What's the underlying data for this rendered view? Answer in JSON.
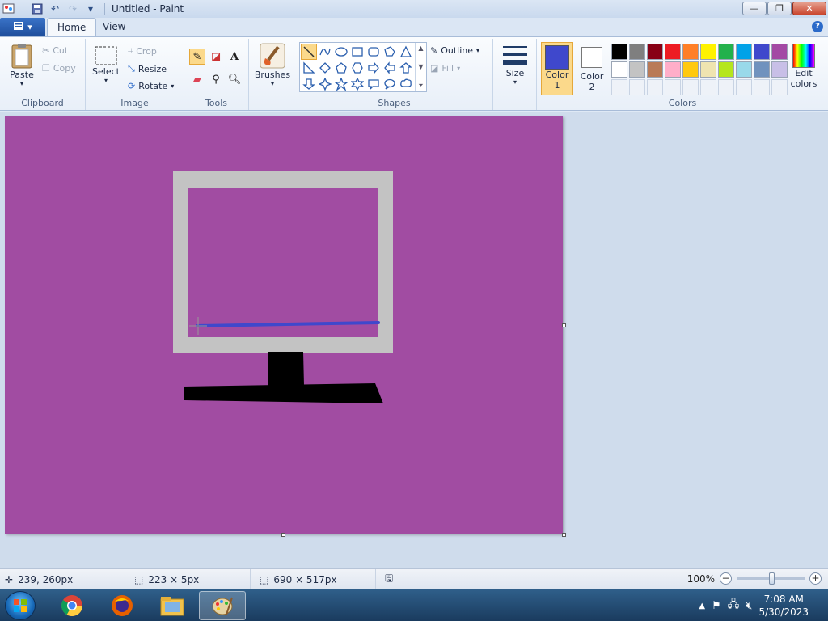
{
  "window": {
    "title": "Untitled - Paint",
    "minimize_glyph": "—",
    "maximize_glyph": "❐",
    "close_glyph": "✕"
  },
  "tabs": [
    {
      "label": "Home",
      "active": true
    },
    {
      "label": "View",
      "active": false
    }
  ],
  "ribbon": {
    "clipboard": {
      "label": "Clipboard",
      "paste": "Paste",
      "cut": "Cut",
      "copy": "Copy"
    },
    "image": {
      "label": "Image",
      "select": "Select",
      "crop": "Crop",
      "resize": "Resize",
      "rotate": "Rotate"
    },
    "tools": {
      "label": "Tools"
    },
    "brushes": {
      "label": "Brushes"
    },
    "shapes": {
      "label": "Shapes",
      "outline": "Outline",
      "fill": "Fill"
    },
    "size": {
      "label": "Size"
    },
    "colors": {
      "label": "Colors",
      "color1_line1": "Color",
      "color1_line2": "1",
      "color2_line1": "Color",
      "color2_line2": "2",
      "edit_line1": "Edit",
      "edit_line2": "colors",
      "color1": "#3f48cc",
      "color2": "#ffffff",
      "palette_row1": [
        "#000000",
        "#7f7f7f",
        "#880015",
        "#ed1c24",
        "#ff7f27",
        "#fff200",
        "#22b14c",
        "#00a2e8",
        "#3f48cc",
        "#a349a4"
      ],
      "palette_row2": [
        "#ffffff",
        "#c3c3c3",
        "#b97a57",
        "#ffaec9",
        "#ffc90e",
        "#efe4b0",
        "#b5e61d",
        "#99d9ea",
        "#7092be",
        "#c8bfe7"
      ]
    }
  },
  "canvas": {
    "background": "#a14ca2",
    "monitor_frame": "#c3c3c3",
    "stand": "#000000",
    "line": "#3f48cc"
  },
  "status": {
    "cursor_pos": "239, 260px",
    "selection_size": "223 × 5px",
    "image_size": "690 × 517px",
    "zoom": "100%"
  },
  "taskbar": {
    "time": "7:08 AM",
    "date": "5/30/2023"
  }
}
